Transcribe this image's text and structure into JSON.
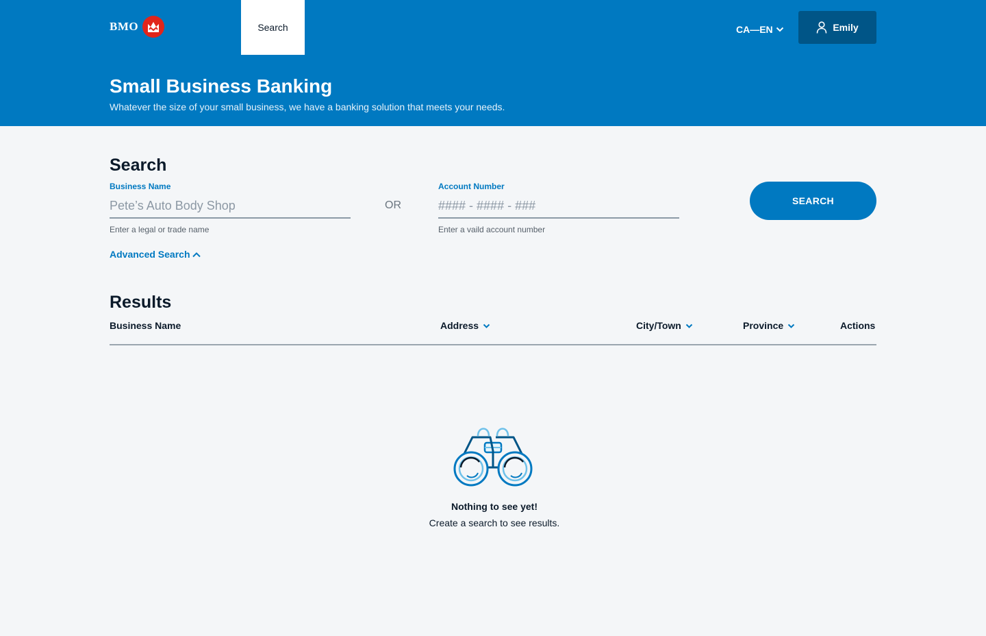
{
  "header": {
    "brand": "BMO",
    "nav_tabs": [
      {
        "label": "Search",
        "active": true
      }
    ],
    "language": "CA—EN",
    "user": "Emily",
    "title": "Small Business Banking",
    "subtitle": "Whatever the size of your small business, we have a banking solution that meets your needs."
  },
  "search": {
    "title": "Search",
    "business_name": {
      "label": "Business Name",
      "value": "",
      "placeholder": "Pete’s Auto Body Shop",
      "help": "Enter a legal or trade name"
    },
    "or_label": "OR",
    "account_number": {
      "label": "Account Number",
      "value": "",
      "placeholder": "#### - #### - ###",
      "help": "Enter a vaild account number"
    },
    "button_label": "SEARCH",
    "advanced_label": "Advanced Search"
  },
  "results": {
    "title": "Results",
    "columns": [
      "Business Name",
      "Address",
      "City/Town",
      "Province",
      "Actions"
    ],
    "empty_title": "Nothing to see yet!",
    "empty_subtitle": "Create a search to see results."
  },
  "icons": {
    "logo": "bmo-roundel-icon",
    "language_caret": "chevron-down-icon",
    "user": "user-icon",
    "advanced_caret": "chevron-up-icon",
    "sort_caret": "chevron-down-icon",
    "empty": "binoculars-icon"
  },
  "colors": {
    "brand_blue": "#0079c1",
    "dark_blue": "#005587",
    "brand_red": "#e1251b",
    "background": "#f4f6f8"
  }
}
